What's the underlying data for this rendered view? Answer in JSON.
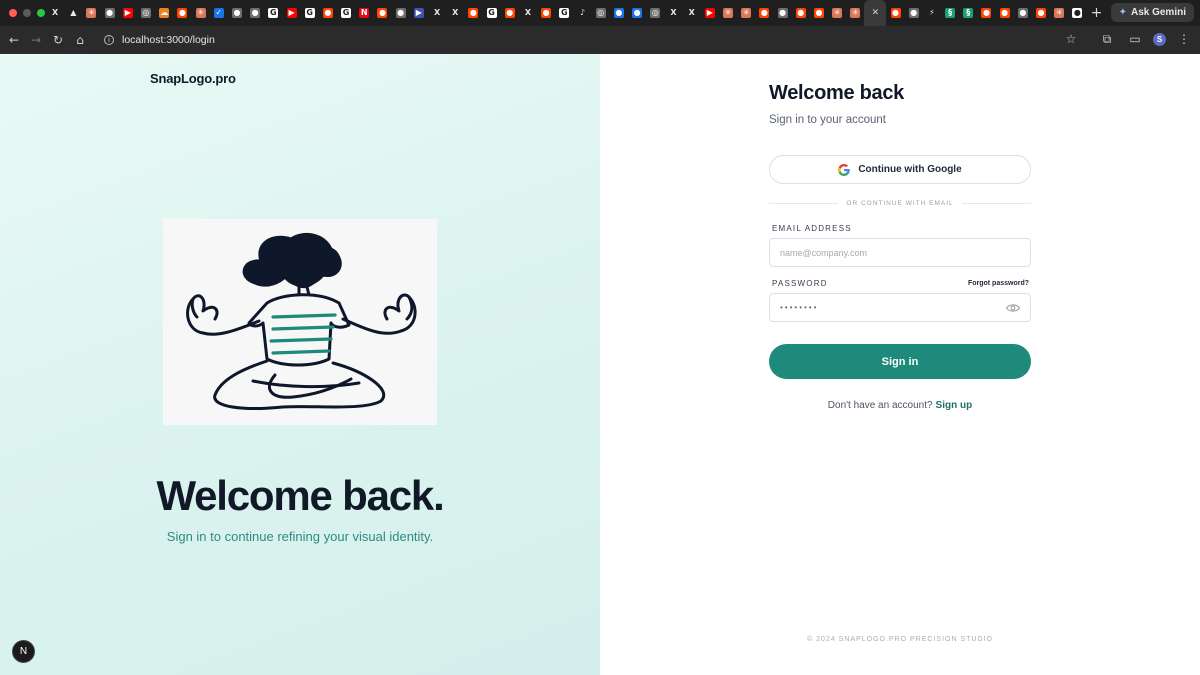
{
  "browser": {
    "tab_favicons": [
      {
        "icon": "x-icon",
        "glyph": "X",
        "color": "#000000"
      },
      {
        "icon": "vercel-icon",
        "glyph": "▲",
        "color": "#000000"
      },
      {
        "icon": "claude-icon",
        "glyph": "✳",
        "color": "#d97757"
      },
      {
        "icon": "github-icon",
        "glyph": "●",
        "color": "#6e6e6e"
      },
      {
        "icon": "youtube-icon",
        "glyph": "▶",
        "color": "#ff0000"
      },
      {
        "icon": "chatgpt-icon",
        "glyph": "◎",
        "color": "#6e6e6e"
      },
      {
        "icon": "cloudflare-icon",
        "glyph": "☁",
        "color": "#f38020"
      },
      {
        "icon": "reddit-icon",
        "glyph": "●",
        "color": "#ff4500"
      },
      {
        "icon": "claude-icon",
        "glyph": "✳",
        "color": "#d97757"
      },
      {
        "icon": "check-icon",
        "glyph": "✓",
        "color": "#1a73e8"
      },
      {
        "icon": "globe-icon",
        "glyph": "●",
        "color": "#6e6e6e"
      },
      {
        "icon": "globe-icon",
        "glyph": "●",
        "color": "#6e6e6e"
      },
      {
        "icon": "google-icon",
        "glyph": "G",
        "color": "#ffffff"
      },
      {
        "icon": "youtube-icon",
        "glyph": "▶",
        "color": "#ff0000"
      },
      {
        "icon": "google-icon",
        "glyph": "G",
        "color": "#ffffff"
      },
      {
        "icon": "reddit-icon",
        "glyph": "●",
        "color": "#ff4500"
      },
      {
        "icon": "google-icon",
        "glyph": "G",
        "color": "#ffffff"
      },
      {
        "icon": "netflix-icon",
        "glyph": "N",
        "color": "#e50914"
      },
      {
        "icon": "reddit-icon",
        "glyph": "●",
        "color": "#ff4500"
      },
      {
        "icon": "github-icon",
        "glyph": "●",
        "color": "#6e6e6e"
      },
      {
        "icon": "play-icon",
        "glyph": "▶",
        "color": "#3f51b5"
      },
      {
        "icon": "x-icon",
        "glyph": "X",
        "color": "#000000"
      },
      {
        "icon": "x-icon",
        "glyph": "X",
        "color": "#000000"
      },
      {
        "icon": "reddit-icon",
        "glyph": "●",
        "color": "#ff4500"
      },
      {
        "icon": "google-icon",
        "glyph": "G",
        "color": "#ffffff"
      },
      {
        "icon": "reddit-icon",
        "glyph": "●",
        "color": "#ff4500"
      },
      {
        "icon": "x-icon",
        "glyph": "X",
        "color": "#000000"
      },
      {
        "icon": "reddit-icon",
        "glyph": "●",
        "color": "#ff4500"
      },
      {
        "icon": "google-icon",
        "glyph": "G",
        "color": "#ffffff"
      },
      {
        "icon": "tiktok-icon",
        "glyph": "♪",
        "color": "#000000"
      },
      {
        "icon": "chatgpt-icon",
        "glyph": "◎",
        "color": "#6e6e6e"
      },
      {
        "icon": "globe-icon",
        "glyph": "●",
        "color": "#1a73e8"
      },
      {
        "icon": "globe-icon",
        "glyph": "●",
        "color": "#1a73e8"
      },
      {
        "icon": "chatgpt-icon",
        "glyph": "◎",
        "color": "#6e6e6e"
      },
      {
        "icon": "x-icon",
        "glyph": "X",
        "color": "#000000"
      },
      {
        "icon": "x-icon",
        "glyph": "X",
        "color": "#000000"
      },
      {
        "icon": "youtube-icon",
        "glyph": "▶",
        "color": "#ff0000"
      },
      {
        "icon": "claude-icon",
        "glyph": "✳",
        "color": "#d97757"
      },
      {
        "icon": "claude-icon",
        "glyph": "✳",
        "color": "#d97757"
      },
      {
        "icon": "reddit-icon",
        "glyph": "●",
        "color": "#ff4500"
      },
      {
        "icon": "github-icon",
        "glyph": "●",
        "color": "#6e6e6e"
      },
      {
        "icon": "reddit-icon",
        "glyph": "●",
        "color": "#ff4500"
      },
      {
        "icon": "reddit-icon",
        "glyph": "●",
        "color": "#ff4500"
      },
      {
        "icon": "claude-icon",
        "glyph": "✳",
        "color": "#d97757"
      },
      {
        "icon": "claude-icon",
        "glyph": "✳",
        "color": "#d97757"
      }
    ],
    "active_tab_close": "✕",
    "tab_favicons_after": [
      {
        "icon": "reddit-icon",
        "glyph": "●",
        "color": "#ff4500"
      },
      {
        "icon": "github-icon",
        "glyph": "●",
        "color": "#6e6e6e"
      },
      {
        "icon": "bolt-icon",
        "glyph": "⚡",
        "color": "#1f1f1f"
      },
      {
        "icon": "perplexity-icon",
        "glyph": "§",
        "color": "#1d9e75"
      },
      {
        "icon": "perplexity-icon",
        "glyph": "§",
        "color": "#1d9e75"
      },
      {
        "icon": "reddit-icon",
        "glyph": "●",
        "color": "#ff4500"
      },
      {
        "icon": "reddit-icon",
        "glyph": "●",
        "color": "#ff4500"
      },
      {
        "icon": "github-icon",
        "glyph": "●",
        "color": "#6e6e6e"
      },
      {
        "icon": "reddit-icon",
        "glyph": "●",
        "color": "#ff4500"
      },
      {
        "icon": "claude-icon",
        "glyph": "✳",
        "color": "#d97757"
      },
      {
        "icon": "github-icon",
        "glyph": "●",
        "color": "#ffffff"
      }
    ],
    "new_tab_label": "+",
    "ask_gemini_label": "Ask Gemini",
    "url": "localhost:3000/login",
    "profile_initial": "S"
  },
  "left_panel": {
    "brand": "SnapLogo.pro",
    "hero_title": "Welcome back.",
    "hero_subtitle": "Sign in to continue refining your visual identity.",
    "dev_badge": "N"
  },
  "form": {
    "title": "Welcome back",
    "subtitle": "Sign in to your account",
    "google_button": "Continue with Google",
    "divider": "OR CONTINUE WITH EMAIL",
    "email_label": "EMAIL ADDRESS",
    "email_placeholder": "name@company.com",
    "password_label": "PASSWORD",
    "forgot_link": "Forgot password?",
    "password_value": "••••••••",
    "submit": "Sign in",
    "signup_prompt": "Don't have an account?",
    "signup_link": "Sign up"
  },
  "footer": "© 2024 SNAPLOGO.PRO PRECISION STUDIO",
  "colors": {
    "accent": "#1e8a7c",
    "accent_text": "#2e8b82",
    "left_bg": "#ddf4f0"
  }
}
